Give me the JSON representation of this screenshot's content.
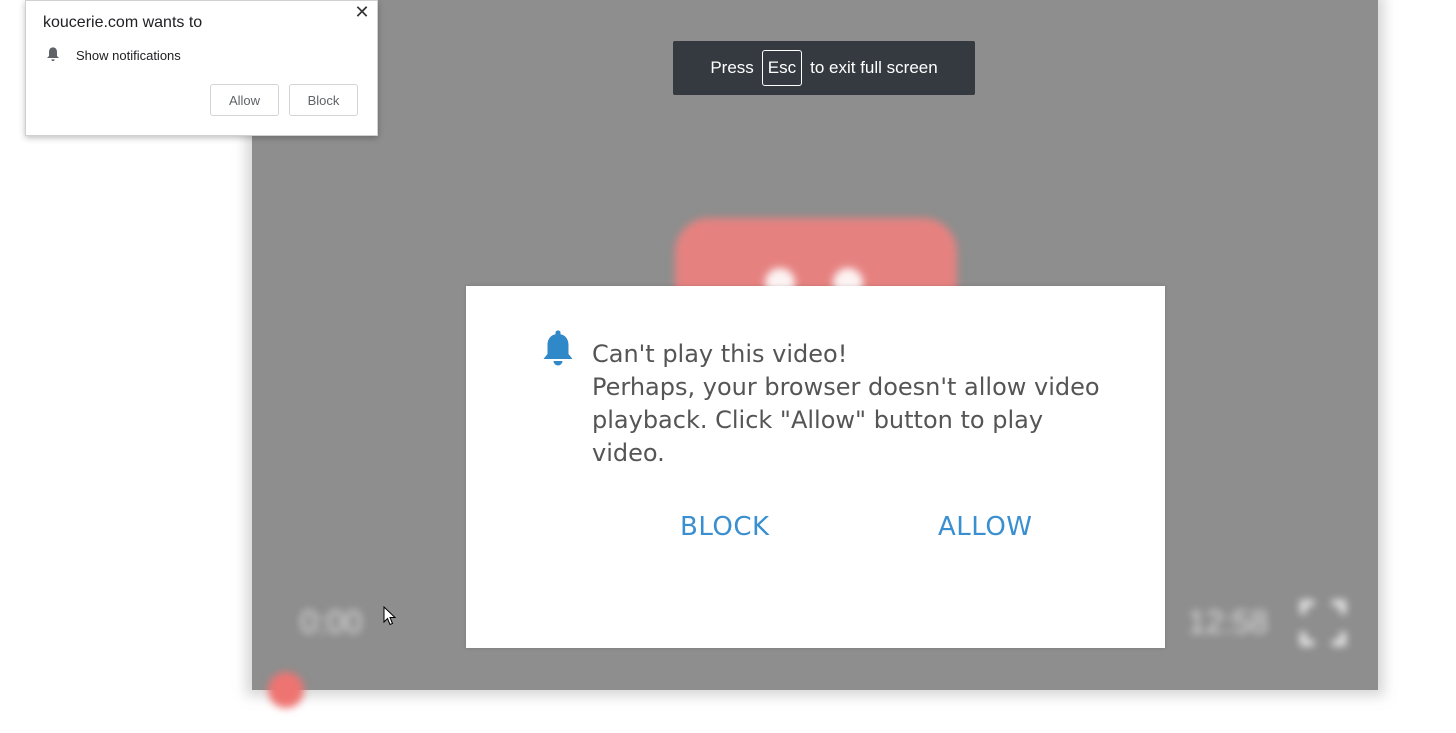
{
  "player": {
    "time_current": "0:00",
    "time_total": "12:58",
    "accent_color": "#e58280",
    "icons": [
      "play-logo-icon",
      "fullscreen-icon"
    ]
  },
  "fullscreen_toast": {
    "press": "Press",
    "key": "Esc",
    "suffix": "to exit full screen"
  },
  "permission_popup": {
    "title": "koucerie.com wants to",
    "close_glyph": "✕",
    "permission": "Show notifications",
    "allow_label": "Allow",
    "block_label": "Block",
    "icon": "bell-icon"
  },
  "modal": {
    "heading": "Can't play this video!",
    "message": "Perhaps, your browser doesn't allow video playback. Click \"Allow\" button to play video.",
    "block_label": "BLOCK",
    "allow_label": "ALLOW",
    "accent_color": "#3a8fd0",
    "icon": "bell-icon"
  }
}
